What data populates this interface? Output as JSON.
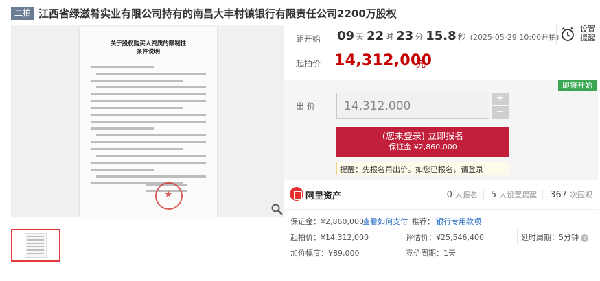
{
  "header": {
    "round_badge": "二拍",
    "title": "江西省绿滋肴实业有限公司持有的南昌大丰村镇银行有限责任公司2200万股权"
  },
  "document_preview": {
    "doc_title": "关于股权购买人资质的限制性\n条件说明"
  },
  "countdown": {
    "label": "距开始",
    "days": "09",
    "days_unit": "天",
    "hours": "22",
    "hours_unit": "时",
    "minutes": "23",
    "minutes_unit": "分",
    "seconds": "15.8",
    "seconds_unit": "秒",
    "start_time": "(2025-05-29 10:00开拍)"
  },
  "remind": {
    "label": "设置\n提醒",
    "icon": "alarm-clock-icon"
  },
  "start_price": {
    "label": "起拍价",
    "value": "14,312,000",
    "unit": "元"
  },
  "bid": {
    "immediate_badge": "即将开始",
    "label": "出 价",
    "input_value": "14,312,000",
    "plus": "+",
    "minus": "−",
    "signup_main": "(您未登录) 立即报名",
    "signup_sub": "保证金 ¥2,860,000",
    "tip_prefix": "提醒：先报名再出价。如您已报名，请",
    "tip_link": "登录"
  },
  "platform": {
    "name": "阿里资产",
    "signups_num": "0",
    "signups_label": "人报名",
    "reminders_num": "5",
    "reminders_label": "人设置提醒",
    "views_num": "367",
    "views_label": "次围观"
  },
  "details": {
    "deposit": "保证金：¥2,860,000",
    "how_to_pay": "查看如何支付",
    "recommend": "推荐：",
    "bank_fund": "银行专用款项",
    "start_price": "起拍价：¥14,312,000",
    "appraisal": "评估价：¥25,546,400",
    "delay_label": "延时周期：",
    "delay_value": "5分钟",
    "increment": "加价幅度：¥89,000",
    "auction_period": "竞价周期：",
    "auction_period_value": "1天"
  },
  "colors": {
    "accent_red": "#c40000",
    "signup_button": "#c2203a",
    "badge_green": "#3aa852",
    "round_badge": "#6b7e95",
    "link_blue": "#2a6fc9"
  }
}
